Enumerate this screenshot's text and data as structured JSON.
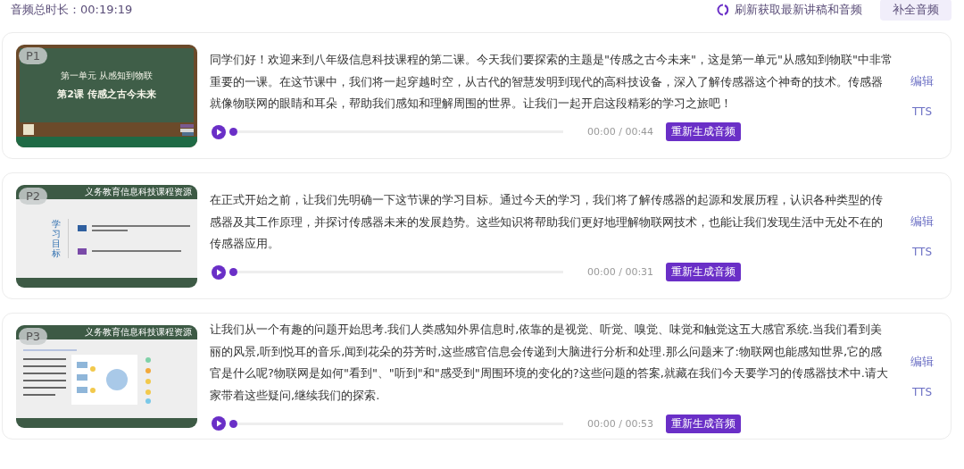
{
  "header": {
    "total_duration": "音频总时长：00:19:19",
    "refresh_link": "刷新获取最新讲稿和音频",
    "fill_button": "补全音频"
  },
  "pages": [
    {
      "thumbnail": {
        "badge": "P1",
        "kind": "chalkboard",
        "lines": [
          "第一单元 从感知到物联",
          "第2课 传感之古今未来"
        ]
      },
      "script": "同学们好！欢迎来到八年级信息科技课程的第二课。今天我们要探索的主题是\"传感之古今未来\"，这是第一单元\"从感知到物联\"中非常重要的一课。在这节课中，我们将一起穿越时空，从古代的智慧发明到现代的高科技设备，深入了解传感器这个神奇的技术。传感器就像物联网的眼睛和耳朵，帮助我们感知和理解周围的世界。让我们一起开启这段精彩的学习之旅吧！",
      "audio": {
        "playing": false,
        "level": 0,
        "time": "00:00 / 00:44",
        "regenerate": "重新生成音频"
      },
      "edit": "编辑",
      "tts": "TTS"
    },
    {
      "thumbnail": {
        "badge": "P2",
        "kind": "objectives",
        "header_right": "义务教育信息科技课程资源",
        "side_label": "学习目标"
      },
      "script": "在正式开始之前，让我们先明确一下这节课的学习目标。通过今天的学习，我们将了解传感器的起源和发展历程，认识各种类型的传感器及其工作原理，并探讨传感器未来的发展趋势。这些知识将帮助我们更好地理解物联网技术，也能让我们发现生活中无处不在的传感器应用。",
      "audio": {
        "playing": false,
        "level": 0,
        "time": "00:00 / 00:31",
        "regenerate": "重新生成音频"
      },
      "edit": "编辑",
      "tts": "TTS"
    },
    {
      "thumbnail": {
        "badge": "P3",
        "kind": "diagram",
        "header_right": "义务教育信息科技课程资源"
      },
      "script": "让我们从一个有趣的问题开始思考.我们人类感知外界信息时,依靠的是视觉、听觉、嗅觉、味觉和触觉这五大感官系统.当我们看到美丽的风景,听到悦耳的音乐,闻到花朵的芬芳时,这些感官信息会传递到大脑进行分析和处理.那么问题来了:物联网也能感知世界,它的感官是什么呢?物联网是如何\"看到\"、\"听到\"和\"感受到\"周围环境的变化的?这些问题的答案,就藏在我们今天要学习的传感器技术中.请大家带着这些疑问,继续我们的探索.",
      "audio": {
        "playing": false,
        "level": 0,
        "time": "00:00 / 00:53",
        "regenerate": "重新生成音频"
      },
      "edit": "编辑",
      "tts": "TTS"
    }
  ]
}
